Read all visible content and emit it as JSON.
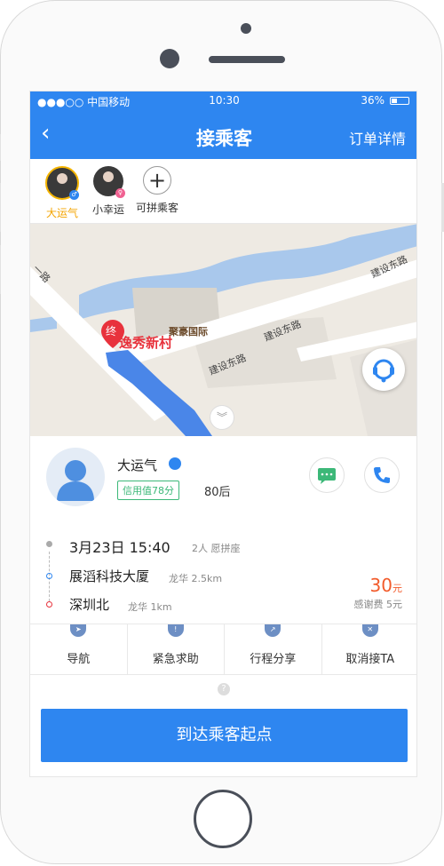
{
  "status_bar": {
    "carrier": "●●●○○ 中国移动",
    "time": "10:30",
    "battery": "36%"
  },
  "nav": {
    "back": "‹",
    "title": "接乘客",
    "right_action": "订单详情"
  },
  "passengers": [
    {
      "name": "大运气",
      "selected": true
    },
    {
      "name": "小幸运",
      "selected": false
    }
  ],
  "add_passenger": {
    "label": "可拼乘客",
    "icon": "+"
  },
  "map": {
    "labels": {
      "road_north": "建设东路",
      "road_center": "建设东路",
      "road_mid": "建设东路",
      "building": "聚豪国际",
      "destination": "逸秀新村",
      "dest_marker": "终",
      "road_left": "一路"
    }
  },
  "passenger": {
    "name": "大运气",
    "credit": "信用值78分",
    "age_group": "80后"
  },
  "trip": {
    "datetime": "3月23日 15:40",
    "seats": "2人 愿拼座",
    "origin": "展滔科技大厦",
    "origin_detail": "龙华 2.5km",
    "destination": "深圳北",
    "destination_detail": "龙华 1km",
    "price": "30",
    "price_unit": "元",
    "fee": "感谢费 5元"
  },
  "actions": [
    {
      "label": "导航",
      "icon": "navigation-icon"
    },
    {
      "label": "紧急求助",
      "icon": "emergency-icon"
    },
    {
      "label": "行程分享",
      "icon": "share-icon"
    },
    {
      "label": "取消接TA",
      "icon": "cancel-icon"
    }
  ],
  "main_button": "到达乘客起点",
  "colors": {
    "primary": "#2e86f0",
    "price": "#f25b2b",
    "credit": "#3cb878",
    "selected": "#f4a400",
    "route": "#4a86e8",
    "marker": "#e8323c"
  }
}
